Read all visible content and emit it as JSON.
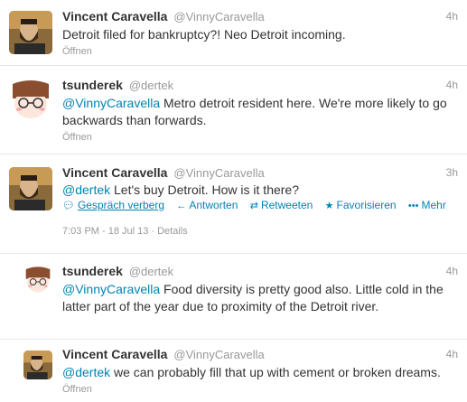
{
  "tweets": [
    {
      "name": "Vincent Caravella",
      "handle": "@VinnyCaravella",
      "time": "4h",
      "mention": "",
      "text": "Detroit filed for bankruptcy?! Neo Detroit incoming.",
      "open_label": "Öffnen",
      "avatar_icon": "bearded-man-avatar"
    },
    {
      "name": "tsunderek",
      "handle": "@dertek",
      "time": "4h",
      "mention": "@VinnyCaravella",
      "text": " Metro detroit resident here. We're more likely to go backwards than forwards.",
      "open_label": "Öffnen",
      "avatar_icon": "anime-girl-avatar"
    },
    {
      "name": "Vincent Caravella",
      "handle": "@VinnyCaravella",
      "time": "3h",
      "mention": "@dertek",
      "text": " Let's buy Detroit. How is it there?",
      "actions": {
        "conversation": "Gespräch verberg",
        "reply": "Antworten",
        "retweet": "Retweeten",
        "favorite": "Favorisieren",
        "more": "Mehr"
      },
      "timestamp": "7:03 PM - 18 Jul 13",
      "details": "Details",
      "avatar_icon": "bearded-man-avatar"
    },
    {
      "name": "tsunderek",
      "handle": "@dertek",
      "time": "4h",
      "mention": "@VinnyCaravella",
      "text": " Food diversity is pretty good also. Little cold in the latter part of the year due to proximity of the Detroit river.",
      "avatar_icon": "anime-girl-avatar"
    },
    {
      "name": "Vincent Caravella",
      "handle": "@VinnyCaravella",
      "time": "4h",
      "mention": "@dertek",
      "text": " we can probably fill that up with cement or broken dreams.",
      "open_label": "Öffnen",
      "avatar_icon": "bearded-man-avatar"
    }
  ],
  "colors": {
    "link": "#0084b4",
    "muted": "#999999",
    "text": "#333333",
    "divider": "#e8e8e8"
  }
}
